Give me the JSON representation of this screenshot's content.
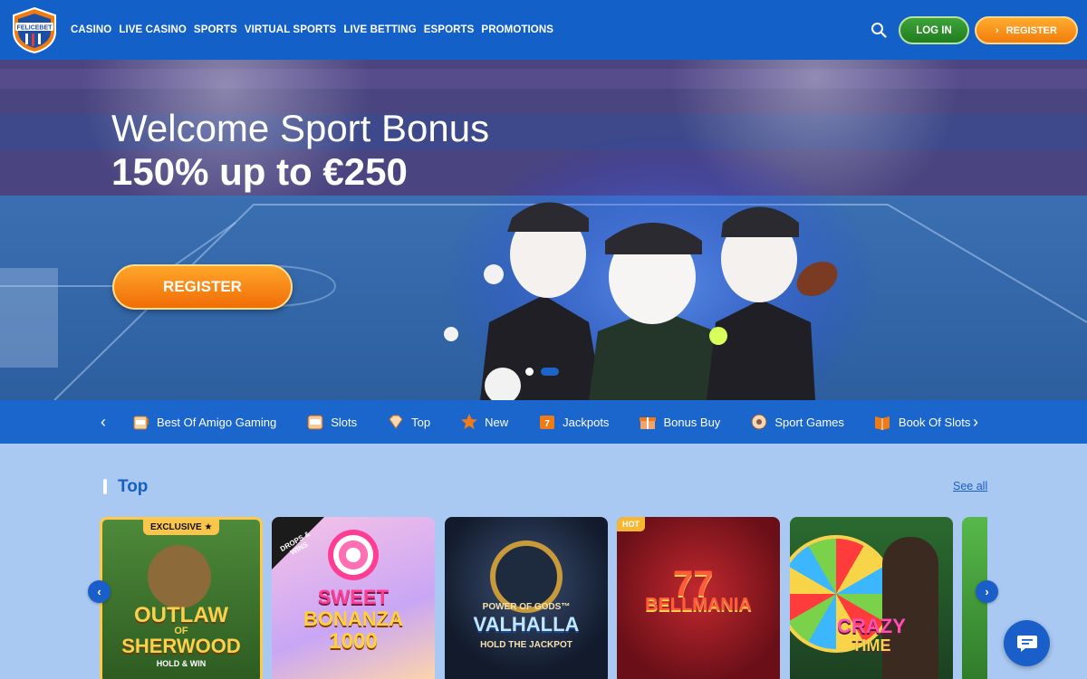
{
  "brand": {
    "logo_text": "FELICEBET"
  },
  "nav": [
    "CASINO",
    "LIVE CASINO",
    "SPORTS",
    "VIRTUAL SPORTS",
    "LIVE BETTING",
    "ESPORTS",
    "PROMOTIONS"
  ],
  "header": {
    "login_label": "LOG IN",
    "register_label": "REGISTER",
    "search_icon": "search-icon"
  },
  "hero": {
    "title": "Welcome Sport Bonus",
    "subtitle": "150% up to €250",
    "cta_label": "REGISTER",
    "slides_total": 2,
    "slide_active": 2
  },
  "categories": [
    {
      "label": "Best Of Amigo Gaming",
      "icon": "slot-machine-icon"
    },
    {
      "label": "Slots",
      "icon": "slots-icon"
    },
    {
      "label": "Top",
      "icon": "diamond-icon"
    },
    {
      "label": "New",
      "icon": "star-icon"
    },
    {
      "label": "Jackpots",
      "icon": "jackpot-icon"
    },
    {
      "label": "Bonus Buy",
      "icon": "gift-icon"
    },
    {
      "label": "Sport Games",
      "icon": "soccer-ball-icon"
    },
    {
      "label": "Book Of Slots",
      "icon": "book-icon"
    }
  ],
  "section": {
    "title": "Top",
    "see_all": "See all"
  },
  "games": [
    {
      "badge": "EXCLUSIVE ★",
      "title": "OUTLAW",
      "title2": "OF",
      "title3": "SHERWOOD",
      "sub": "HOLD & WIN"
    },
    {
      "badge": "DROPS & WINS",
      "title": "SWEET",
      "title2": "BONANZA",
      "title3": "1000",
      "sub": ""
    },
    {
      "badge": "",
      "title": "POWER OF GODS™",
      "title2": "VALHALLA",
      "title3": "",
      "sub": "HOLD THE JACKPOT"
    },
    {
      "badge": "HOT",
      "title": "BELLMANIA",
      "title2": "",
      "title3": "",
      "sub": ""
    },
    {
      "badge": "",
      "title": "CRAZY",
      "title2": "TIME",
      "title3": "",
      "sub": ""
    }
  ],
  "colors": {
    "header": "#1460c9",
    "accent_orange": "#f27d0c",
    "login_green": "#2a8f2a",
    "page_bg": "#a9c9f3"
  }
}
